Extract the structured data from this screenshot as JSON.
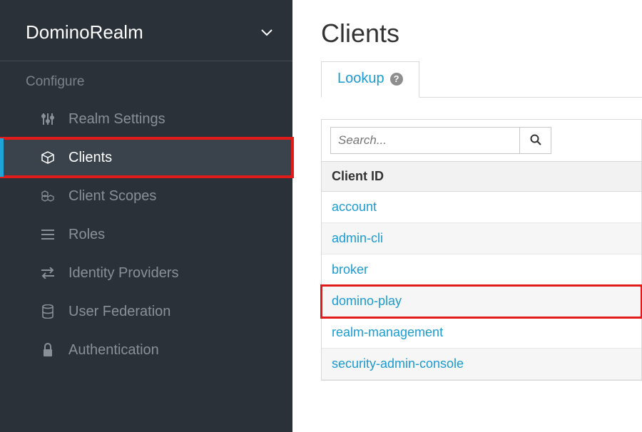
{
  "sidebar": {
    "realm": "DominoRealm",
    "section_label": "Configure",
    "items": [
      {
        "label": "Realm Settings",
        "icon": "sliders-icon"
      },
      {
        "label": "Clients",
        "icon": "cube-icon",
        "active": true,
        "highlighted": true
      },
      {
        "label": "Client Scopes",
        "icon": "cubes-icon"
      },
      {
        "label": "Roles",
        "icon": "list-icon"
      },
      {
        "label": "Identity Providers",
        "icon": "exchange-icon"
      },
      {
        "label": "User Federation",
        "icon": "database-icon"
      },
      {
        "label": "Authentication",
        "icon": "lock-icon"
      }
    ]
  },
  "main": {
    "title": "Clients",
    "tab": {
      "label": "Lookup"
    },
    "search": {
      "placeholder": "Search..."
    },
    "table": {
      "header": "Client ID",
      "rows": [
        {
          "id": "account"
        },
        {
          "id": "admin-cli"
        },
        {
          "id": "broker"
        },
        {
          "id": "domino-play",
          "highlighted": true
        },
        {
          "id": "realm-management"
        },
        {
          "id": "security-admin-console"
        }
      ]
    }
  }
}
